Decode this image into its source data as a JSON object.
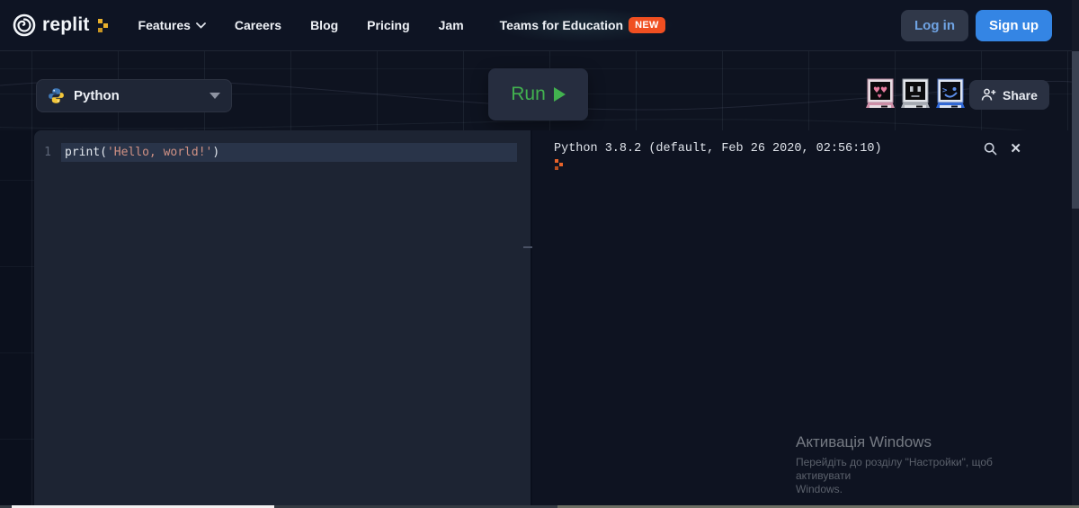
{
  "nav": {
    "logo_text": "replit",
    "items": [
      {
        "label": "Features"
      },
      {
        "label": "Careers"
      },
      {
        "label": "Blog"
      },
      {
        "label": "Pricing"
      },
      {
        "label": "Jam"
      },
      {
        "label": "Teams for Education"
      }
    ],
    "new_badge": "NEW",
    "login_label": "Log in",
    "signup_label": "Sign up"
  },
  "toolbar": {
    "language_selector": {
      "value": "Python",
      "icon": "python-logo"
    },
    "run_label": "Run",
    "share_label": "Share",
    "avatars": [
      "heart-face-computer",
      "neutral-face-computer",
      "wink-face-computer"
    ]
  },
  "editor": {
    "code": {
      "line_number": "1",
      "t1": "print(",
      "t2": "'Hello, world!'",
      "t3": ")"
    }
  },
  "console": {
    "version_line": "Python 3.8.2 (default, Feb 26 2020, 02:56:10)",
    "icons": [
      "search-icon",
      "close-icon"
    ]
  },
  "watermark": {
    "title": "Активація Windows",
    "line1": "Перейдіть до розділу \"Настройки\", щоб активувати",
    "line2": "Windows."
  },
  "colors": {
    "badge_orange": "#f04f21",
    "signup_blue": "#3485e4",
    "login_text_blue": "#6fa3e3",
    "run_green": "#42b24f",
    "string_salmon": "#cf9184",
    "prompt_orange": "#e8632a",
    "logo_gold": "#e9b02c",
    "navbar_bg": "#0e1423",
    "editor_bg": "#1d2433",
    "console_bg": "#0e1321"
  }
}
